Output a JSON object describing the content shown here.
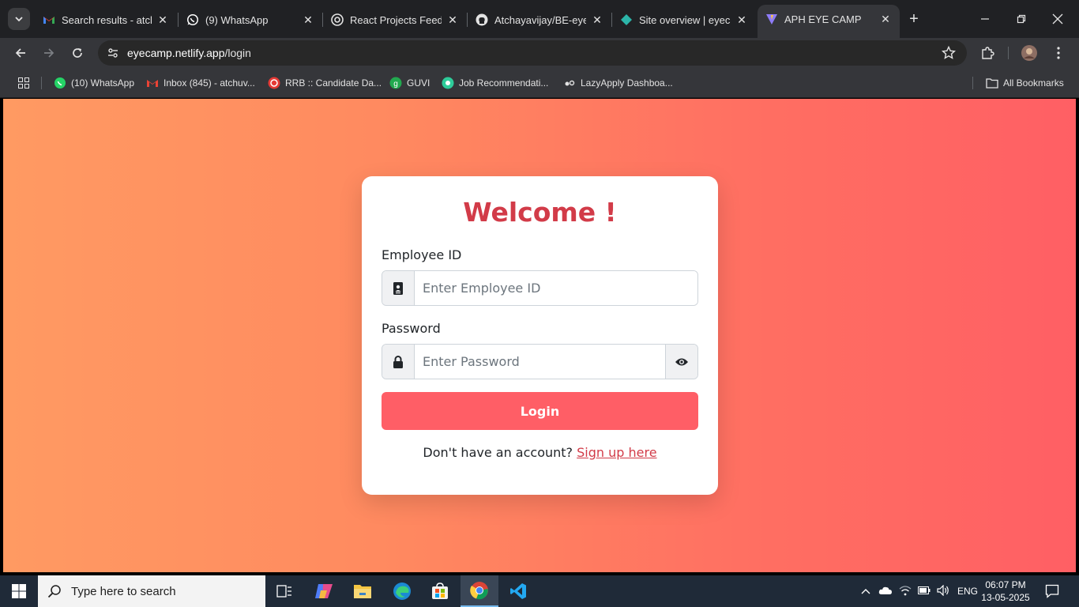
{
  "browser": {
    "tabs": [
      {
        "title": "Search results - atchu",
        "favicon": "gmail-icon",
        "active": false
      },
      {
        "title": "(9) WhatsApp",
        "favicon": "whatsapp-icon",
        "active": false
      },
      {
        "title": "React Projects Feedb",
        "favicon": "chatgpt-icon",
        "active": false
      },
      {
        "title": "Atchayavijay/BE-eyec",
        "favicon": "github-icon",
        "active": false
      },
      {
        "title": "Site overview | eyeca",
        "favicon": "netlify-icon",
        "active": false
      },
      {
        "title": "APH EYE CAMP",
        "favicon": "vite-icon",
        "active": true
      }
    ],
    "url_host": "eyecamp.netlify.app",
    "url_path": "/login",
    "bookmarks": [
      {
        "label": "(10) WhatsApp",
        "icon": "whatsapp-icon"
      },
      {
        "label": "Inbox (845) - atchuv...",
        "icon": "gmail-icon"
      },
      {
        "label": "RRB :: Candidate Da...",
        "icon": "rrb-icon"
      },
      {
        "label": "GUVI",
        "icon": "guvi-icon"
      },
      {
        "label": "Job Recommendati...",
        "icon": "job-icon"
      },
      {
        "label": "LazyApply Dashboa...",
        "icon": "lazyapply-icon"
      }
    ],
    "all_bookmarks": "All Bookmarks"
  },
  "login": {
    "title": "Welcome !",
    "employee_label": "Employee ID",
    "employee_placeholder": "Enter Employee ID",
    "password_label": "Password",
    "password_placeholder": "Enter Password",
    "login_button": "Login",
    "signup_prompt": "Don't have an account?",
    "signup_link": "Sign up here"
  },
  "taskbar": {
    "search_placeholder": "Type here to search",
    "language": "ENG",
    "time": "06:07 PM",
    "date": "13-05-2025"
  },
  "colors": {
    "accent": "#d23b48",
    "button": "#ff5e66",
    "gradient_start": "#ff9a62",
    "gradient_end": "#ff5f64"
  }
}
